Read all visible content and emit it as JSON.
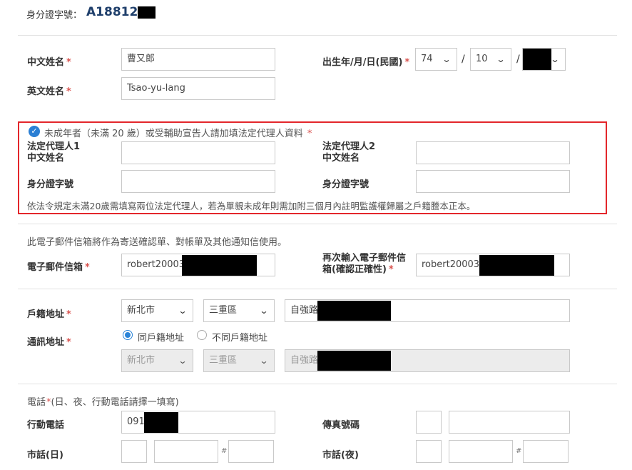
{
  "id_header": {
    "label": "身分證字號：",
    "value": "A188128"
  },
  "name_zh": {
    "label": "中文姓名",
    "required": "*",
    "value": "曹又郎"
  },
  "name_en": {
    "label": "英文姓名",
    "required": "*",
    "value": "Tsao-yu-lang"
  },
  "birth": {
    "label": "出生年/月/日(民國)",
    "required": "*",
    "year": "74",
    "month": "10",
    "sep": "/"
  },
  "guardian": {
    "toggle_label": "未成年者（未滿 20 歲）或受輔助宣告人請加填法定代理人資料",
    "required": "*",
    "rep1_line1": "法定代理人1",
    "rep1_line2": "中文姓名",
    "rep2_line1": "法定代理人2",
    "rep2_line2": "中文姓名",
    "id1_label": "身分證字號",
    "id2_label": "身分證字號",
    "note": "依法令規定未滿20歲需填寫兩位法定代理人，若為單親未成年則需加附三個月內註明監護權歸屬之戶籍謄本正本。"
  },
  "email": {
    "note": "此電子郵件信箱將作為寄送確認單、對帳單及其他通知信使用。",
    "label": "電子郵件信箱",
    "required": "*",
    "value": "robert20003",
    "confirm_line1": "再次輸入電子郵件信",
    "confirm_line2": "箱(確認正確性)",
    "confirm_value": "robert200035"
  },
  "household": {
    "label": "戶籍地址",
    "required": "*",
    "city": "新北市",
    "district": "三重區",
    "street": "自強路"
  },
  "mailing": {
    "label": "通訊地址",
    "required": "*",
    "option_same": "同戶籍地址",
    "option_diff": "不同戶籍地址",
    "city": "新北市",
    "district": "三重區",
    "street": "自強路"
  },
  "phone": {
    "section_label": "電話",
    "required": "*",
    "section_hint": "(日、夜、行動電話請擇一填寫)",
    "mobile_label": "行動電話",
    "mobile_value": "0916",
    "fax_label": "傳真號碼",
    "day_label": "市話(日)",
    "night_label": "市話(夜)",
    "ext_mark": "#"
  },
  "colors": {
    "required": "#d9534f",
    "accent": "#2a7fd4",
    "highlight_border": "#e3262b"
  }
}
